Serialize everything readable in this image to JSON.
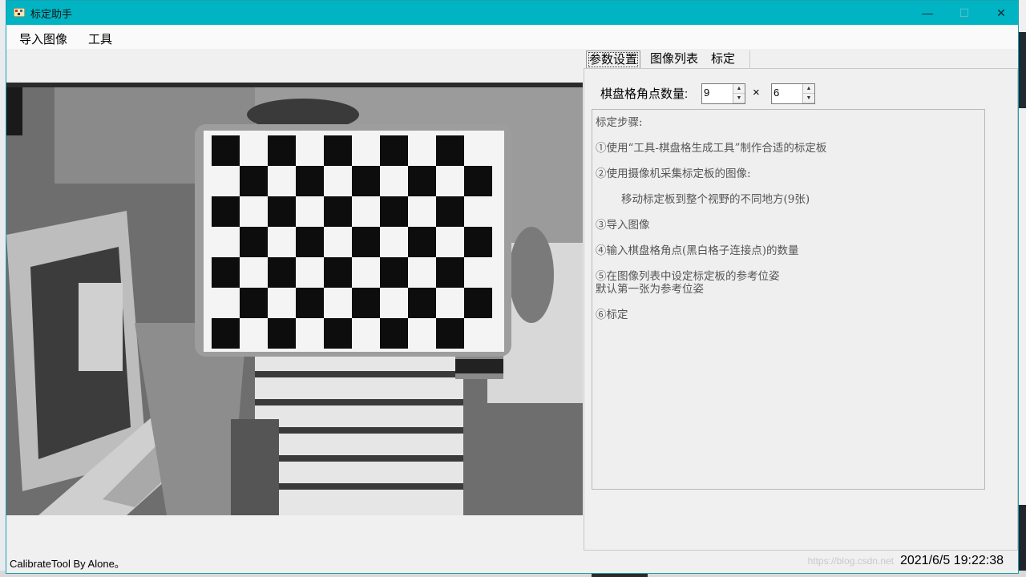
{
  "window": {
    "title": "标定助手",
    "minimize": "—",
    "maximize": "☐",
    "close": "✕"
  },
  "menu": [
    "导入图像",
    "工具"
  ],
  "tabs": [
    "参数设置",
    "图像列表",
    "标定"
  ],
  "params": {
    "corner_label": "棋盘格角点数量:",
    "cols": "9",
    "rows": "6",
    "times": "×"
  },
  "steps": {
    "title": "标定步骤:",
    "s1": "①使用“工具-棋盘格生成工具”制作合适的标定板",
    "s2": "②使用摄像机采集标定板的图像:",
    "s2b": "移动标定板到整个视野的不同地方(9张)",
    "s3": "③导入图像",
    "s4": "④输入棋盘格角点(黑白格子连接点)的数量",
    "s5": "⑤在图像列表中设定标定板的参考位姿",
    "s5b": "默认第一张为参考位姿",
    "s6": "⑥标定"
  },
  "status": {
    "left": "CalibrateTool By Alone。",
    "right": "2021/6/5 19:22:38",
    "watermark": "https://blog.csdn.net"
  },
  "colors": {
    "titlebar": "#00b4c4",
    "panel": "#f0f0f0"
  }
}
